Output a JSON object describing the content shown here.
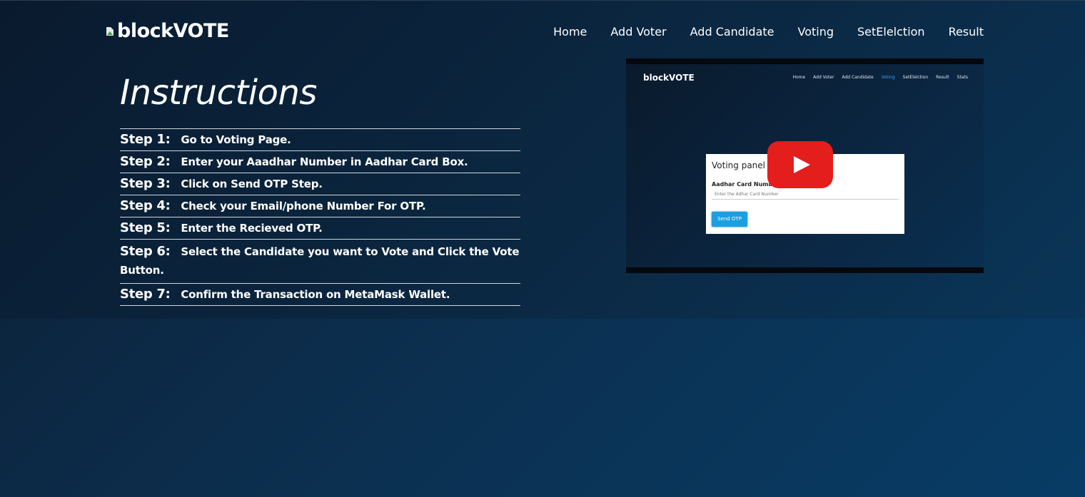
{
  "header": {
    "logo_text": "blockVOTE",
    "nav": [
      "Home",
      "Add Voter",
      "Add Candidate",
      "Voting",
      "SetElelction",
      "Result"
    ]
  },
  "main": {
    "title": "Instructions",
    "steps": [
      {
        "label": "Step 1:",
        "text": "Go to Voting Page."
      },
      {
        "label": "Step 2:",
        "text": "Enter your Aaadhar Number in Aadhar Card Box."
      },
      {
        "label": "Step 3:",
        "text": "Click on Send OTP Step."
      },
      {
        "label": "Step 4:",
        "text": "Check your Email/phone Number For OTP."
      },
      {
        "label": "Step 5:",
        "text": "Enter the Recieved OTP."
      },
      {
        "label": "Step 6:",
        "text": "Select the Candidate you want to Vote and Click the Vote Button."
      },
      {
        "label": "Step 7:",
        "text": "Confirm the Transaction on MetaMask Wallet."
      }
    ]
  },
  "video": {
    "logo_text": "blockVOTE",
    "nav": [
      "Home",
      "Add Voter",
      "Add Candidate",
      "Voting",
      "SetElelction",
      "Result",
      "Stats"
    ],
    "active_nav": "Voting",
    "panel_title": "Voting panel",
    "field_label": "Aadhar Card Number",
    "field_placeholder": "Enter the Adhar Card Number",
    "button_label": "Send OTP",
    "play_icon": "youtube-play-icon"
  },
  "colors": {
    "youtube_red": "#e41d1d",
    "active_nav": "#3aa0ff",
    "send_button": "#1aa0e0"
  }
}
